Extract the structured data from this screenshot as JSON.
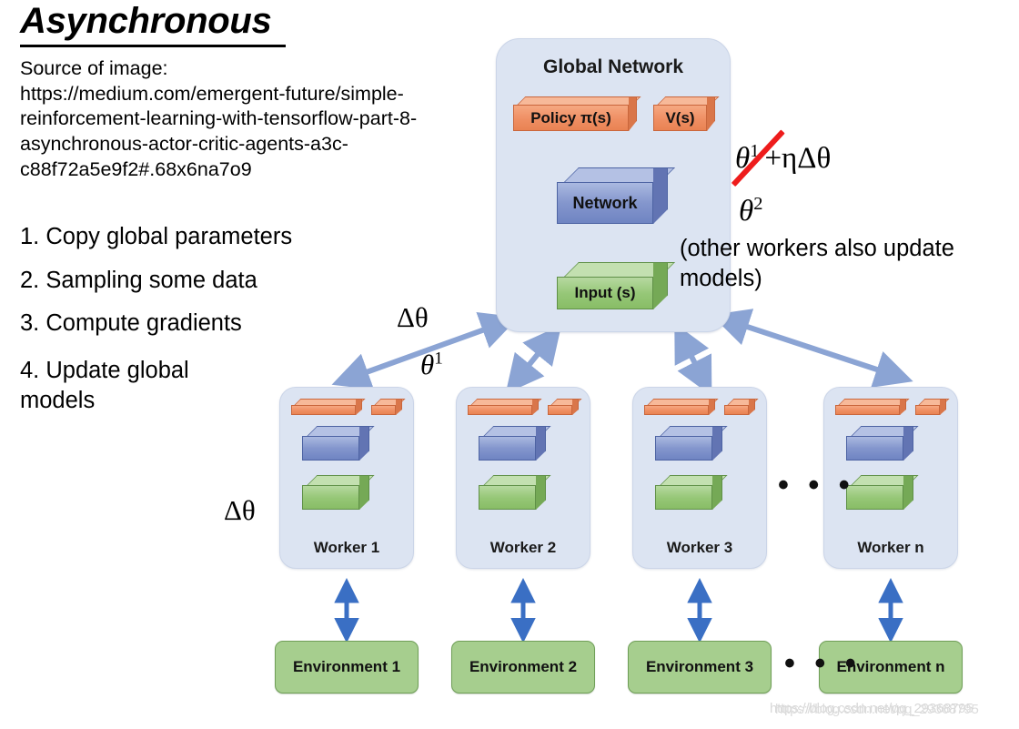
{
  "slide": {
    "title": "Asynchronous",
    "source_label": "Source of image:",
    "source_url": "https://medium.com/emergent-future/simple-reinforcement-learning-with-tensorflow-part-8-asynchronous-actor-critic-agents-a3c-c88f72a5e9f2#.68x6na7o9",
    "steps": [
      "1. Copy global parameters",
      "2. Sampling some data",
      "3. Compute gradients",
      "4. Update global models"
    ]
  },
  "global_network": {
    "title": "Global Network",
    "policy_label": "Policy π(s)",
    "value_label": "V(s)",
    "network_label": "Network",
    "input_label": "Input (s)"
  },
  "annotations": {
    "equation_theta": "θ",
    "equation_sup1": "1",
    "equation_rest": "+ηΔθ",
    "equation_line2_theta": "θ",
    "equation_line2_sup": "2",
    "other_workers_note": "(other workers also update models)",
    "delta_theta_top": "Δθ",
    "theta1_mid": "θ",
    "theta1_mid_sup": "1",
    "delta_theta_left": "Δθ",
    "theta1_worker1": "θ",
    "theta1_worker1_sup": "1",
    "workers_ellipsis": "• • •",
    "envs_ellipsis": "• • •"
  },
  "workers": [
    {
      "label": "Worker 1"
    },
    {
      "label": "Worker 2"
    },
    {
      "label": "Worker 3"
    },
    {
      "label": "Worker n"
    }
  ],
  "environments": [
    {
      "label": "Environment 1"
    },
    {
      "label": "Environment 2"
    },
    {
      "label": "Environment 3"
    },
    {
      "label": "Environment n"
    }
  ],
  "watermark": {
    "text": "https://blog.csdn.net/qq_29368795"
  },
  "colors": {
    "panel_blue": "#dce4f2",
    "box_orange": "#ef8f63",
    "box_blue": "#8496cd",
    "box_green": "#96c777",
    "env_green": "#a6ce8e",
    "arrow_blue": "#8ba4d4",
    "env_arrow_blue": "#3a6fc4",
    "strike_red": "#ee1c1c"
  }
}
